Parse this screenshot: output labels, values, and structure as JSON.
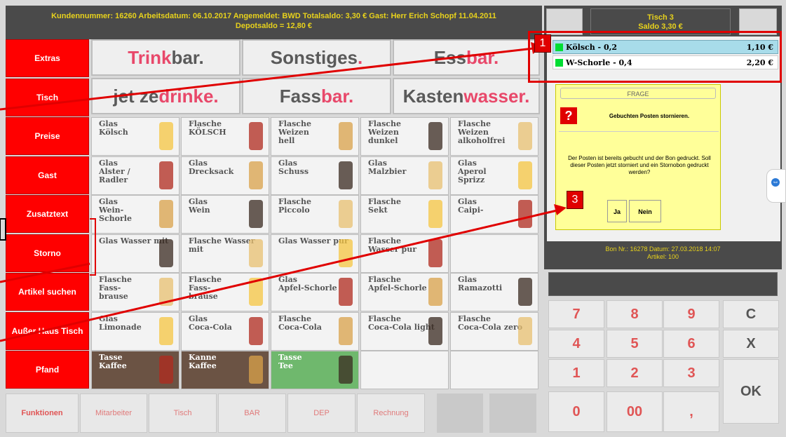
{
  "header": {
    "line1": "Kundennummer: 16260 Arbeitsdatum: 06.10.2017 Angemeldet: BWD  Totalsaldo:  3,30 € Gast: Herr Erich Schopf 11.04.2011",
    "line2": "Depotsaldo = 12,80 €"
  },
  "table_panel": {
    "title": "Tisch 3",
    "saldo": "Saldo 3,30 €"
  },
  "left_menu": [
    "Extras",
    "Tisch",
    "Preise",
    "Gast",
    "Zusatztext",
    "Storno",
    "Artikel suchen",
    "Außer Haus Tisch",
    "Pfand"
  ],
  "categories": [
    {
      "a": "Trink",
      "b": "bar."
    },
    {
      "a": "Sonstiges",
      "b": "."
    },
    {
      "a": "Ess",
      "b": "bar."
    },
    {
      "a": "jet ze",
      "b": "drinke."
    },
    {
      "a": "Fass",
      "b": "bar."
    },
    {
      "a": "Kasten",
      "b": "wasser."
    }
  ],
  "products": [
    "Glas\nKölsch",
    "Flasche\nKÖLSCH",
    "Flasche\nWeizen\nhell",
    "Flasche\nWeizen\ndunkel",
    "Flasche\nWeizen\nalkoholfrei",
    "Glas\nAlster /\nRadler",
    "Glas\nDrecksack",
    "Glas\nSchuss",
    "Glas\nMalzbier",
    "Glas\nAperol\nSprizz",
    "Glas\nWein-\nSchorle",
    "Glas\nWein",
    "Flasche\nPiccolo",
    "Flasche\nSekt",
    "Glas\nCaipi-",
    "Glas Wasser mit",
    "Flasche Wasser\nmit",
    "Glas Wasser pur",
    "Flasche\nWasser pur",
    "",
    "Flasche\nFass-\nbrause",
    "Flasche\nFass-\nbrause",
    "Glas\nApfel-Schorle",
    "Flasche\nApfel-Schorle",
    "Glas\nRamazotti",
    "Glas\nLimonade",
    "Glas\nCoca-Cola",
    "Flasche\nCoca-Cola",
    "Flasche\nCoca-Cola light",
    "Flasche\nCoca-Cola zero",
    "Tasse\nKaffee",
    "Kanne\nKaffee",
    "Tasse\nTee",
    "",
    ""
  ],
  "footer": [
    "Funktionen",
    "Mitarbeiter",
    "Tisch",
    "BAR",
    "DEP",
    "Rechnung",
    "",
    ""
  ],
  "order": [
    {
      "name": "Kölsch - 0,2",
      "price": "1,10 €"
    },
    {
      "name": "W-Schorle - 0,4",
      "price": "2,20 €"
    }
  ],
  "dialog": {
    "header": "FRAGE",
    "title": "Gebuchten Posten stornieren.",
    "message": "Der Posten ist bereits gebucht und der Bon gedruckt. Soll dieser Posten jetzt storniert und ein Stornobon gedruckt werden?",
    "yes": "Ja",
    "no": "Nein"
  },
  "bon": {
    "line1": "Bon Nr.: 16278  Datum: 27.03.2018 14:07",
    "line2": "Artikel: 100"
  },
  "numpad": [
    "7",
    "8",
    "9",
    "C",
    "4",
    "5",
    "6",
    "X",
    "1",
    "2",
    "3",
    "OK",
    "0",
    "00",
    ","
  ],
  "callouts": [
    "1",
    "3"
  ],
  "colors": {
    "accent": "#ff0000",
    "header_text": "#e8d21c",
    "dialog_bg": "#ffff99",
    "order_sel": "#a8dcea"
  }
}
